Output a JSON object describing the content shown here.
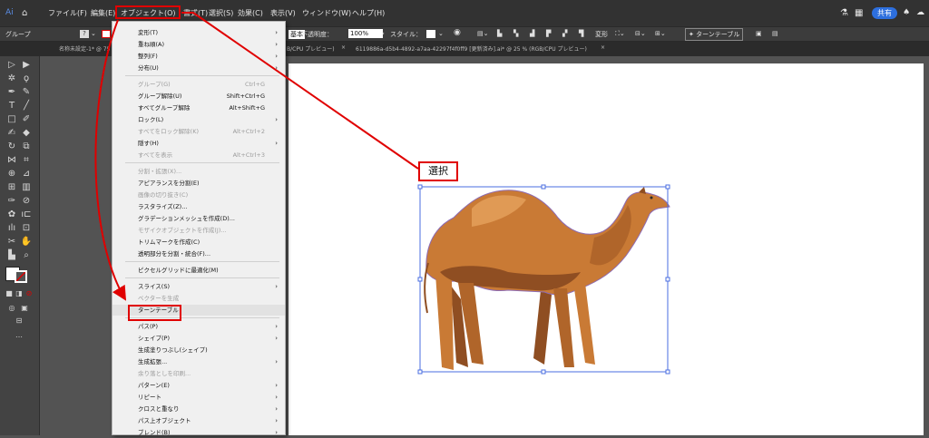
{
  "menubar": {
    "items": [
      "ファイル(F)",
      "編集(E)",
      "オブジェクト(O)",
      "書式(T)",
      "選択(S)",
      "効果(C)",
      "表示(V)",
      "ウィンドウ(W)",
      "ヘルプ(H)"
    ],
    "share_label": "共有"
  },
  "controlbar": {
    "group_label": "グループ",
    "basic_label": "基本",
    "opacity_label": "不透明度：",
    "opacity_value": "100%",
    "style_label": "スタイル：",
    "transform_label": "変形",
    "turntable_label": "ターンテーブル"
  },
  "tabs": {
    "doc1": "名称未設定-1* @ 75 % (R",
    "doc2": "B/CPU プレビュー)",
    "doc3": "6119886a-d5b4-4892-a7aa-42297f4f0ff9 [更新済み].ai* @ 25 % (RGB/CPU プレビュー)"
  },
  "menu": {
    "items": [
      {
        "label": "変形(T)",
        "shortcut": "",
        "submenu": true,
        "disabled": false
      },
      {
        "label": "重ね順(A)",
        "shortcut": "",
        "submenu": true,
        "disabled": false
      },
      {
        "label": "整列(F)",
        "shortcut": "",
        "submenu": true,
        "disabled": false
      },
      {
        "label": "分布(U)",
        "shortcut": "",
        "submenu": true,
        "disabled": false
      },
      {
        "label": "グループ(G)",
        "shortcut": "Ctrl+G",
        "submenu": false,
        "disabled": true
      },
      {
        "label": "グループ解除(U)",
        "shortcut": "Shift+Ctrl+G",
        "submenu": false,
        "disabled": false
      },
      {
        "label": "すべてグループ解除",
        "shortcut": "Alt+Shift+G",
        "submenu": false,
        "disabled": false
      },
      {
        "label": "ロック(L)",
        "shortcut": "",
        "submenu": true,
        "disabled": false
      },
      {
        "label": "すべてをロック解除(K)",
        "shortcut": "Alt+Ctrl+2",
        "submenu": false,
        "disabled": true
      },
      {
        "label": "隠す(H)",
        "shortcut": "",
        "submenu": true,
        "disabled": false
      },
      {
        "label": "すべてを表示",
        "shortcut": "Alt+Ctrl+3",
        "submenu": false,
        "disabled": true
      },
      {
        "label": "分割・拡張(X)...",
        "shortcut": "",
        "submenu": false,
        "disabled": true
      },
      {
        "label": "アピアランスを分割(E)",
        "shortcut": "",
        "submenu": false,
        "disabled": false
      },
      {
        "label": "画像の切り抜き(C)",
        "shortcut": "",
        "submenu": false,
        "disabled": true
      },
      {
        "label": "ラスタライズ(Z)...",
        "shortcut": "",
        "submenu": false,
        "disabled": false
      },
      {
        "label": "グラデーションメッシュを作成(D)...",
        "shortcut": "",
        "submenu": false,
        "disabled": false
      },
      {
        "label": "モザイクオブジェクトを作成(J)...",
        "shortcut": "",
        "submenu": false,
        "disabled": true
      },
      {
        "label": "トリムマークを作成(C)",
        "shortcut": "",
        "submenu": false,
        "disabled": false
      },
      {
        "label": "透明部分を分割・統合(F)...",
        "shortcut": "",
        "submenu": false,
        "disabled": false
      },
      {
        "label": "ピクセルグリッドに最適化(M)",
        "shortcut": "",
        "submenu": false,
        "disabled": false
      },
      {
        "label": "スライス(S)",
        "shortcut": "",
        "submenu": true,
        "disabled": false
      },
      {
        "label": "ベクターを生成",
        "shortcut": "",
        "submenu": false,
        "disabled": true
      },
      {
        "label": "ターンテーブル",
        "shortcut": "",
        "submenu": false,
        "disabled": false
      },
      {
        "label": "パス(P)",
        "shortcut": "",
        "submenu": true,
        "disabled": false
      },
      {
        "label": "シェイプ(P)",
        "shortcut": "",
        "submenu": true,
        "disabled": false
      },
      {
        "label": "生成塗りつぶし(シェイプ)",
        "shortcut": "",
        "submenu": false,
        "disabled": false
      },
      {
        "label": "生成拡張...",
        "shortcut": "",
        "submenu": true,
        "disabled": false
      },
      {
        "label": "余り落としを印刷...",
        "shortcut": "",
        "submenu": false,
        "disabled": true
      },
      {
        "label": "パターン(E)",
        "shortcut": "",
        "submenu": true,
        "disabled": false
      },
      {
        "label": "リピート",
        "shortcut": "",
        "submenu": true,
        "disabled": false
      },
      {
        "label": "クロスと重なり",
        "shortcut": "",
        "submenu": true,
        "disabled": false
      },
      {
        "label": "パス上オブジェクト",
        "shortcut": "",
        "submenu": true,
        "disabled": false
      },
      {
        "label": "ブレンド(B)",
        "shortcut": "",
        "submenu": true,
        "disabled": false
      }
    ]
  },
  "annotation": {
    "callout_text": "選択",
    "color": "#e00000"
  },
  "colors": {
    "camel_body": "#c97a35",
    "camel_shadow": "#8f4e22",
    "camel_light": "#e09a55",
    "selection": "#4a6ee0"
  }
}
